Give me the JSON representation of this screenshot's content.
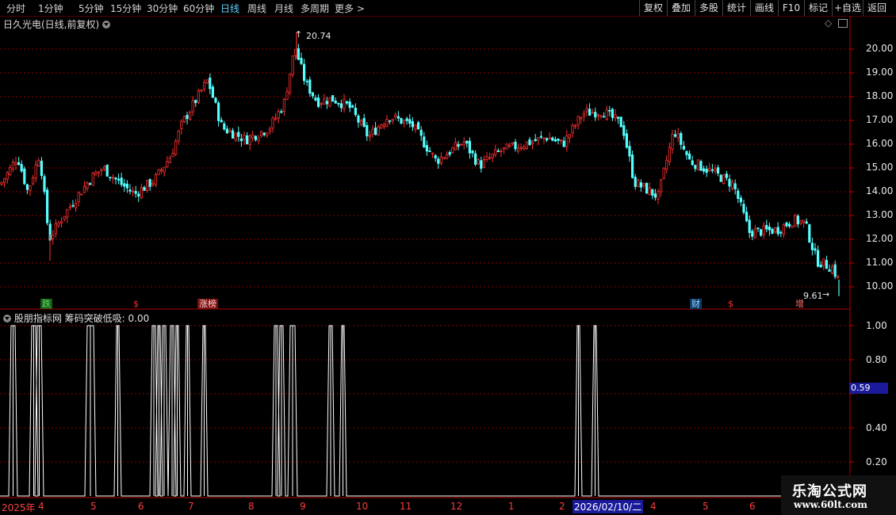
{
  "toolbar": {
    "timeframes": [
      "分时",
      "1分钟",
      "5分钟",
      "15分钟",
      "30分钟",
      "60分钟",
      "日线",
      "周线",
      "月线",
      "多周期",
      "更多 >"
    ],
    "active_timeframe": "日线",
    "buttons": [
      "复权",
      "叠加",
      "多股",
      "统计",
      "画线",
      "F10",
      "标记",
      "+自选",
      "返回"
    ]
  },
  "chart": {
    "title": "日久光电(日线,前复权)",
    "high_label": "20.74",
    "low_label": "9.61",
    "price_axis": [
      "20.00",
      "19.00",
      "18.00",
      "17.00",
      "16.00",
      "15.00",
      "14.00",
      "13.00",
      "12.00",
      "11.00",
      "10.00"
    ],
    "markers": [
      {
        "text": "跌",
        "color": "#3fbf3f",
        "bg": "#1b5e1b"
      },
      {
        "text": "$",
        "color": "#ff3030",
        "bg": "#000"
      },
      {
        "text": "涨榜",
        "color": "#ffd0d0",
        "bg": "#7a1010"
      },
      {
        "text": "财",
        "color": "#9fd6ff",
        "bg": "#0d3b66"
      },
      {
        "text": "$",
        "color": "#ff3030",
        "bg": "#000"
      },
      {
        "text": "增",
        "color": "#ff7070",
        "bg": "#000"
      }
    ]
  },
  "indicator": {
    "title": "股朋指标网 筹码突破低吸: 0.00",
    "axis": [
      "1.00",
      "0.80",
      "0.40",
      "0.20"
    ],
    "cursor_value": "0.59"
  },
  "dates": {
    "labels": [
      "2025年",
      "4",
      "5",
      "6",
      "7",
      "8",
      "9",
      "10",
      "11",
      "12",
      "1",
      "2",
      "4",
      "5",
      "6"
    ],
    "highlight": "2026/02/10/二"
  },
  "watermark": {
    "line1": "乐淘公式网",
    "line2": "www.60lt.com"
  },
  "colors": {
    "up": "#ff3030",
    "down": "#54ffff",
    "grid": "#8a0000",
    "axis": "#b00000",
    "signal": "#ffffff"
  }
}
